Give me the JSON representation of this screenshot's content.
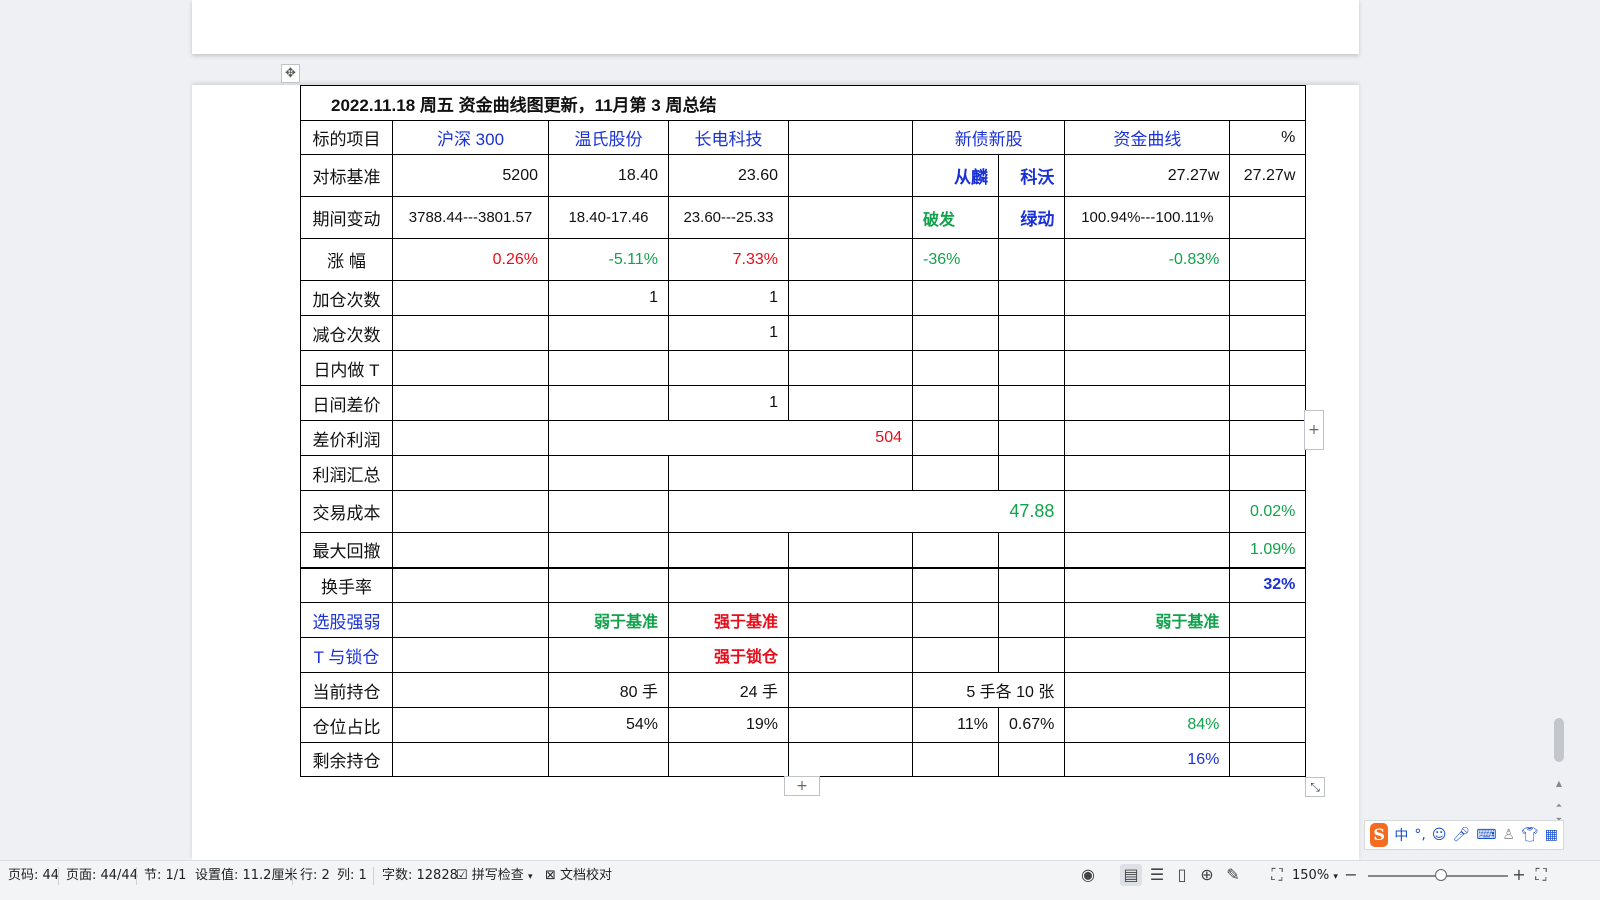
{
  "table": {
    "title": "2022.11.18 周五 资金曲线图更新，11月第 3 周总结",
    "header": [
      "标的项目",
      "沪深 300",
      "温氏股份",
      "长电科技",
      "",
      "新债新股",
      "资金曲线",
      "%"
    ],
    "benchmark": {
      "label": "对标基准",
      "hs300": "5200",
      "wens": "18.40",
      "cdkj": "23.60",
      "bond1": "从麟",
      "bond2": "科沃",
      "curve": "27.27w",
      "pct": "27.27w"
    },
    "change": {
      "label": "期间变动",
      "hs300": "3788.44---3801.57",
      "wens": "18.40-17.46",
      "cdkj": "23.60---25.33",
      "bond1": "破发",
      "bond2": "绿动",
      "curve": "100.94%---100.11%"
    },
    "gain": {
      "label": "涨  幅",
      "hs300": "0.26%",
      "wens": "-5.11%",
      "cdkj": "7.33%",
      "bond1": "-36%",
      "curve": "-0.83%"
    },
    "add_times": {
      "label": "加仓次数",
      "wens": "1",
      "cdkj": "1"
    },
    "reduce_times": {
      "label": "减仓次数",
      "cdkj": "1"
    },
    "intraday_t": {
      "label": "日内做 T"
    },
    "interday_spread": {
      "label": "日间差价",
      "cdkj": "1"
    },
    "spread_profit": {
      "label": "差价利润",
      "value": "504"
    },
    "profit_total": {
      "label": "利润汇总"
    },
    "trade_cost": {
      "label": "交易成本",
      "value": "47.88",
      "pct": "0.02%"
    },
    "max_drawdown": {
      "label": "最大回撤",
      "pct": "1.09%"
    },
    "turnover": {
      "label": "换手率",
      "pct": "32%"
    },
    "stock_strength": {
      "label": "选股强弱",
      "wens": "弱于基准",
      "cdkj": "强于基准",
      "curve": "弱于基准"
    },
    "t_lock": {
      "label": "T 与锁仓",
      "cdkj": "强于锁仓"
    },
    "holding": {
      "label": "当前持仓",
      "wens": "80 手",
      "cdkj": "24 手",
      "bond": "5 手各 10 张"
    },
    "position_ratio": {
      "label": "仓位占比",
      "wens": "54%",
      "cdkj": "19%",
      "bond1": "11%",
      "bond2": "0.67%",
      "curve": "84%"
    },
    "remaining": {
      "label": "剩余持仓",
      "curve": "16%"
    }
  },
  "status": {
    "page_no": "页码: 44",
    "pages": "页面: 44/44",
    "section": "节: 1/1",
    "setting": "设置值: 11.2厘米",
    "row": "行: 2",
    "col": "列: 1",
    "words": "字数: 12828",
    "spell": "拼写检查",
    "proof": "文档校对",
    "zoom": "150%"
  },
  "ime": {
    "lang": "中"
  },
  "colors": {
    "red": "#e60e1c",
    "green": "#11a24b",
    "blue": "#1a31d8"
  }
}
